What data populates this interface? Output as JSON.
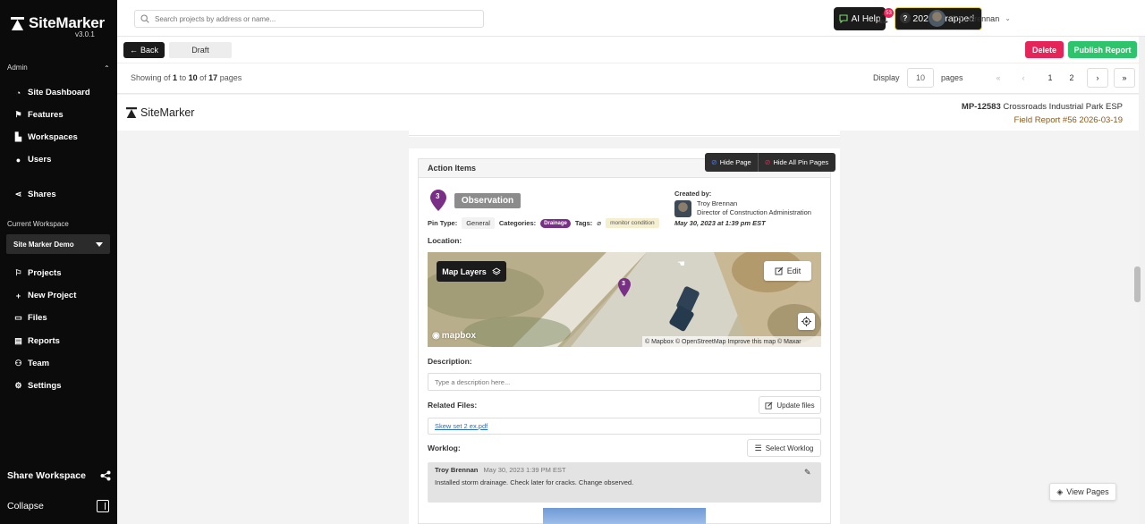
{
  "app": {
    "name": "SiteMarker",
    "version": "v3.0.1"
  },
  "sidebar": {
    "admin_label": "Admin",
    "admin_items": [
      {
        "label": "Site Dashboard",
        "icon": "dashboard-icon"
      },
      {
        "label": "Features",
        "icon": "flag-icon"
      },
      {
        "label": "Workspaces",
        "icon": "buildings-icon"
      },
      {
        "label": "Users",
        "icon": "user-icon"
      },
      {
        "label": "Shares",
        "icon": "share-icon"
      }
    ],
    "current_workspace_label": "Current Workspace",
    "workspace": "Site Marker Demo",
    "workspace_items": [
      {
        "label": "Projects",
        "icon": "flag-outline-icon"
      },
      {
        "label": "New Project",
        "icon": "plus-icon"
      },
      {
        "label": "Files",
        "icon": "folder-icon"
      },
      {
        "label": "Reports",
        "icon": "clipboard-icon"
      },
      {
        "label": "Team",
        "icon": "team-icon"
      },
      {
        "label": "Settings",
        "icon": "gear-icon"
      }
    ],
    "share_workspace": "Share Workspace",
    "collapse": "Collapse"
  },
  "topbar": {
    "search_placeholder": "Search projects by address or name...",
    "ai_help": "AI Help",
    "wrapped": "2025 Wrapped",
    "notification_count": "53",
    "help": "?",
    "user_name": "Troy Brennan"
  },
  "actionbar": {
    "back": "Back",
    "status": "Draft",
    "delete": "Delete",
    "publish": "Publish Report"
  },
  "pagination": {
    "showing_prefix": "Showing of",
    "from": "1",
    "to_word": "to",
    "to": "10",
    "of_word": "of",
    "total": "17",
    "suffix": "pages",
    "display_label": "Display",
    "display_value": "10",
    "pages_label": "pages",
    "page_1": "1",
    "page_2": "2"
  },
  "report_header": {
    "brand": "SiteMarker",
    "project_id": "MP-12583",
    "project_name": "Crossroads Industrial Park ESP",
    "field_report": "Field Report #56 2026-03-19"
  },
  "action_items": {
    "title": "Action Items",
    "hide_page": "Hide Page",
    "hide_all": "Hide All Pin Pages",
    "pin_number": "3",
    "pin_type_label": "Observation",
    "created_by_label": "Created by:",
    "creator_name": "Troy Brennan",
    "creator_title": "Director of Construction Administration",
    "created_date": "May 30, 2023 at 1:39 pm EST",
    "meta": {
      "pin_type_label": "Pin Type:",
      "pin_type": "General",
      "categories_label": "Categories:",
      "category": "Drainage",
      "tags_label": "Tags:",
      "tag": "monitor condition"
    },
    "location_label": "Location:",
    "map": {
      "layers": "Map Layers",
      "edit": "Edit",
      "logo": "mapbox",
      "attribution": "© Mapbox © OpenStreetMap Improve this map © Maxar",
      "pin_number": "3"
    },
    "description_label": "Description:",
    "description_placeholder": "Type a description here...",
    "related_files_label": "Related Files:",
    "update_files": "Update files",
    "file_name": "Skew set 2 ex.pdf",
    "worklog_label": "Worklog:",
    "select_worklog": "Select Worklog",
    "worklog_entry": {
      "author": "Troy Brennan",
      "date": "May 30, 2023 1:39 PM EST",
      "text": "Installed storm drainage. Check later for cracks. Change observed."
    }
  },
  "view_pages": "View Pages",
  "colors": {
    "sidebar_bg": "#0b0b0b",
    "delete": "#e5245a",
    "publish": "#2dc46c",
    "pin_purple": "#7a2f86",
    "wrapped_border": "#e8d44d"
  }
}
